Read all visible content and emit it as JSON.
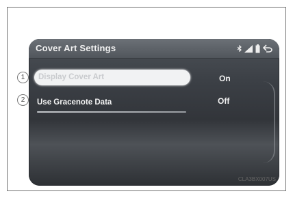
{
  "screen": {
    "title": "Cover Art Settings",
    "rows": [
      {
        "callout": "1",
        "label": "Display Cover Art",
        "value": "On",
        "selected": true
      },
      {
        "callout": "2",
        "label": "Use Gracenote Data",
        "value": "Off",
        "selected": false
      }
    ],
    "status_icons": [
      "bluetooth-icon",
      "signal-strength-icon",
      "battery-icon",
      "back-arrow-icon"
    ]
  },
  "figure_code": "CLA3BX007US",
  "colors": {
    "header": "#5f6469",
    "screen_background": "#3a3d42",
    "selection": "#f1f2f3",
    "text": "#f2f2f2"
  }
}
